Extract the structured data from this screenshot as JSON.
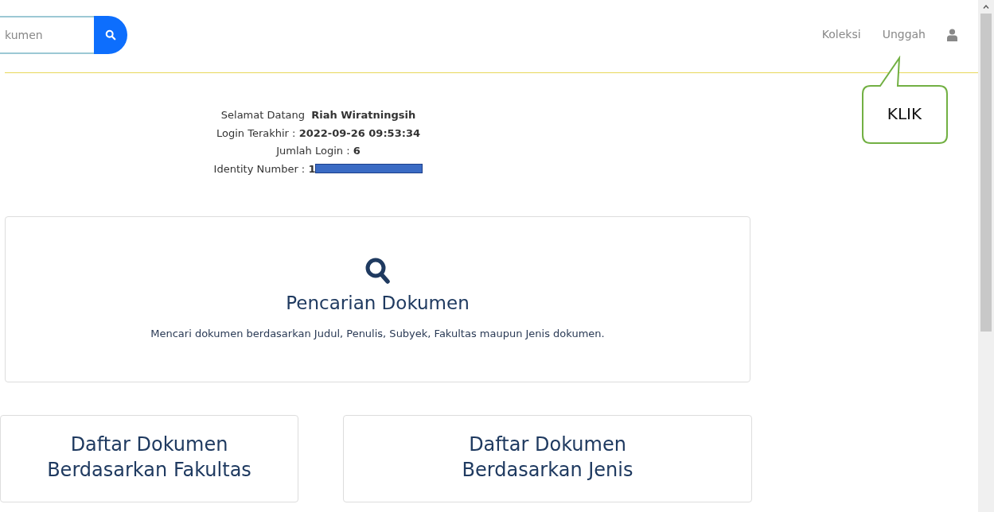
{
  "search": {
    "placeholder": "kumen"
  },
  "nav": [
    {
      "label": "Koleksi"
    },
    {
      "label": "Unggah"
    }
  ],
  "callout": {
    "text": "KLIK"
  },
  "welcome": [
    {
      "text": "Selamat Datang  **Riah Wiratningsih**"
    },
    {
      "text": "Login Terakhir : **2022-09-26 09:53:34**"
    },
    {
      "text": "Jumlah Login : **6**"
    },
    {
      "text": "Identity Number : **1**",
      "redacted": true
    }
  ],
  "search_card": {
    "title": "Pencarian Dokumen",
    "description": "Mencari dokumen berdasarkan Judul, Penulis, Subyek, Fakultas maupun Jenis dokumen."
  },
  "cards": [
    {
      "title_lines": [
        "Daftar Dokumen",
        "Berdasarkan Fakultas"
      ]
    },
    {
      "title_lines": [
        "Daftar Dokumen",
        "Berdasarkan Jenis"
      ]
    }
  ]
}
